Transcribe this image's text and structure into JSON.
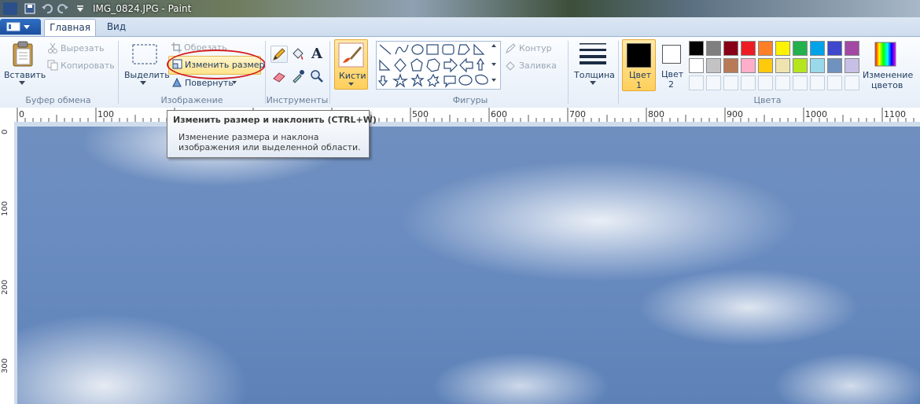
{
  "window": {
    "title": "IMG_0824.JPG - Paint"
  },
  "tabs": [
    {
      "label": "Главная",
      "active": true
    },
    {
      "label": "Вид",
      "active": false
    }
  ],
  "clipboard": {
    "paste": "Вставить",
    "cut": "Вырезать",
    "copy": "Копировать",
    "group_label": "Буфер обмена"
  },
  "image": {
    "select": "Выделить",
    "crop": "Обрезать",
    "resize": "Изменить размер",
    "rotate": "Повернуть",
    "group_label": "Изображение"
  },
  "tools": {
    "group_label": "Инструменты",
    "text_icon": "A"
  },
  "brushes": {
    "label": "Кисти"
  },
  "shapes": {
    "outline": "Контур",
    "fill": "Заливка",
    "group_label": "Фигуры"
  },
  "size": {
    "label": "Толщина"
  },
  "colors": {
    "color1_label": "Цвет\n1",
    "color1_line1": "Цвет",
    "color1_line2": "1",
    "color2_line1": "Цвет",
    "color2_line2": "2",
    "edit_line1": "Изменение",
    "edit_line2": "цветов",
    "group_label": "Цвета",
    "color1_value": "#000000",
    "color2_value": "#ffffff",
    "palette_row1": [
      "#000000",
      "#7f7f7f",
      "#880015",
      "#ed1c24",
      "#ff7f27",
      "#fff200",
      "#22b14c",
      "#00a2e8",
      "#3f48cc",
      "#a349a4"
    ],
    "palette_row2": [
      "#ffffff",
      "#c3c3c3",
      "#b97a57",
      "#ffaec9",
      "#ffc90e",
      "#efe4b0",
      "#b5e61d",
      "#99d9ea",
      "#7092be",
      "#c8bfe7"
    ]
  },
  "ruler": {
    "h": [
      "0",
      "100",
      "500",
      "600",
      "700",
      "800",
      "900",
      "1000",
      "1100"
    ],
    "v": [
      "0",
      "100",
      "200",
      "300"
    ]
  },
  "tooltip": {
    "title": "Изменить размер и наклонить (CTRL+W)",
    "description": "Изменение размера и наклона изображения или выделенной области."
  }
}
